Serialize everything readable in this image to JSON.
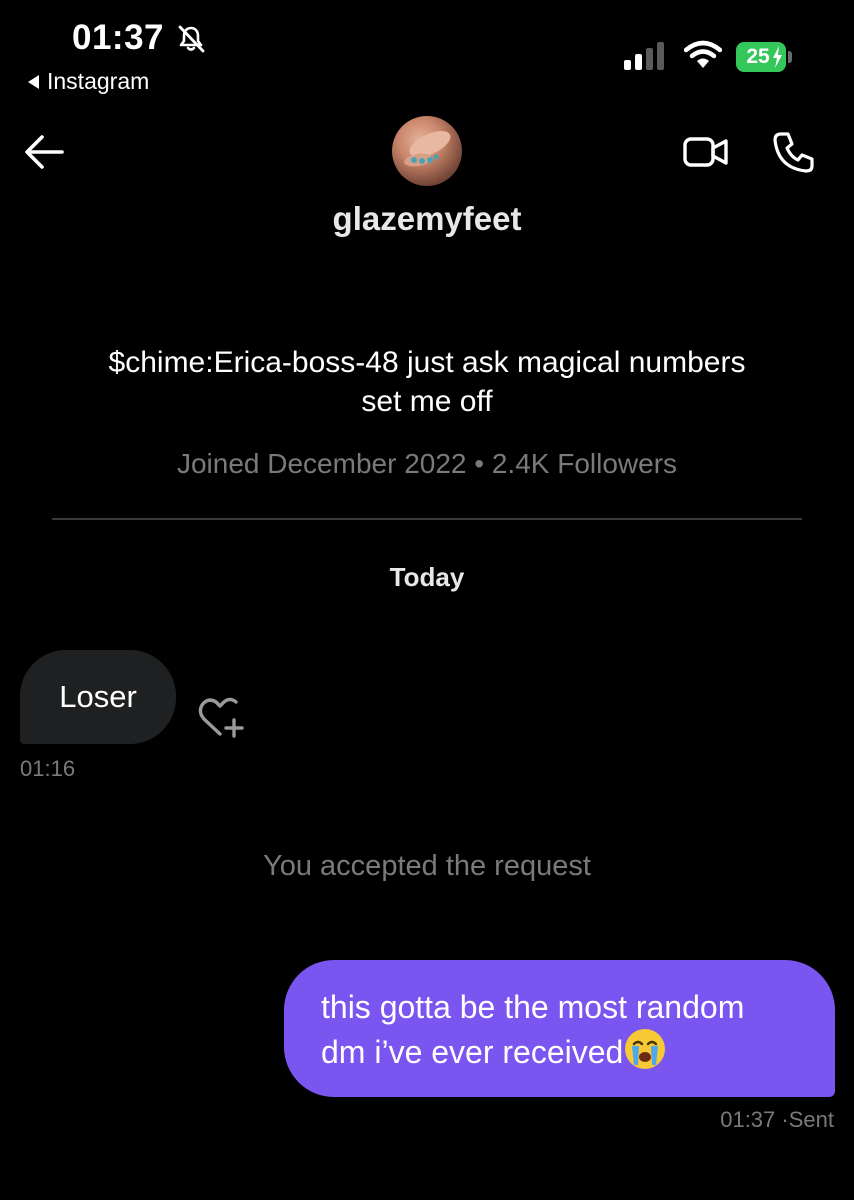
{
  "status_bar": {
    "time": "01:37",
    "back_app": "Instagram",
    "battery": "25",
    "icons": [
      "bell-muted-icon",
      "signal-icon",
      "wifi-icon",
      "battery-icon"
    ]
  },
  "header": {
    "username": "glazemyfeet",
    "icons": [
      "back-arrow-icon",
      "video-call-icon",
      "phone-call-icon"
    ]
  },
  "profile": {
    "bio_line1": "$chime:Erica-boss-48 just ask magical numbers",
    "bio_line2": "set me off",
    "meta": "Joined December 2022 • 2.4K Followers"
  },
  "conversation": {
    "day_label": "Today",
    "messages": [
      {
        "direction": "incoming",
        "text": "Loser",
        "time": "01:16"
      },
      {
        "direction": "system",
        "text": "You accepted the request"
      },
      {
        "direction": "outgoing",
        "line1": "this gotta be the most random",
        "line2": "dm i’ve ever received",
        "emoji": "loudly-crying-face",
        "time": "01:37",
        "status": "Sent"
      }
    ]
  },
  "colors": {
    "background": "#000000",
    "incoming_bubble": "#1f2022",
    "outgoing_bubble": "#7b55f0",
    "muted_text": "#7a7a7a",
    "battery": "#34c759"
  }
}
